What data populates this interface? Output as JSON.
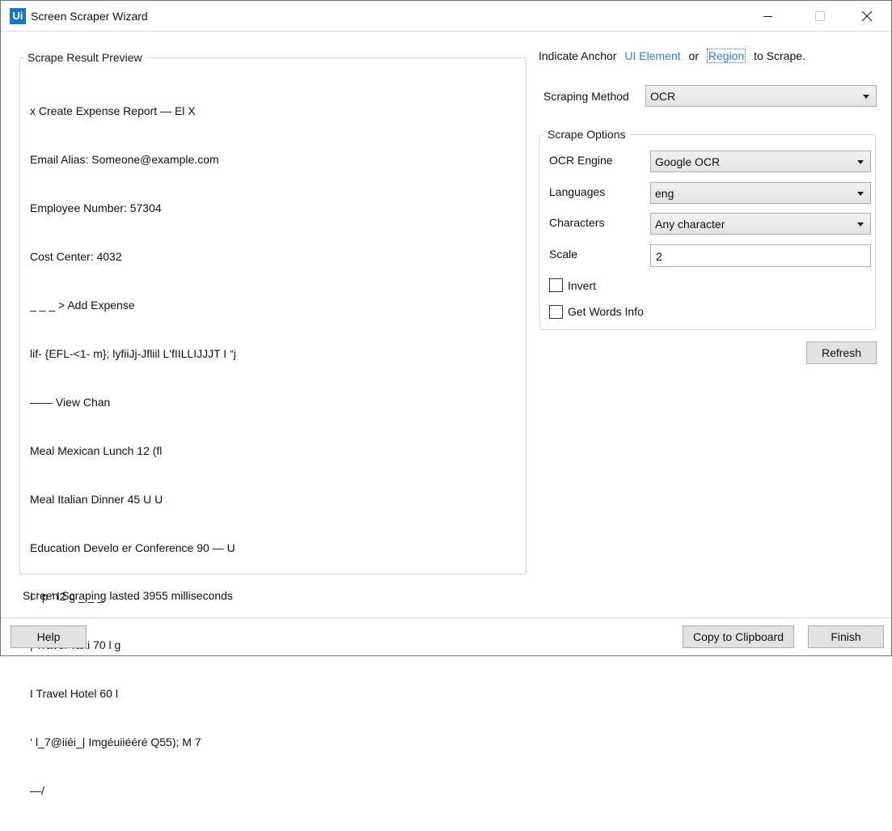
{
  "window": {
    "title": "Screen Scraper Wizard",
    "logo_text": "Ui"
  },
  "preview": {
    "legend": "Scrape Result Preview",
    "lines": [
      "x Create Expense Report — El X",
      "Email Alias: Someone@example.com",
      "Employee Number: 57304",
      "Cost Center: 4032",
      "_ _ _ > Add Expense",
      "lif- {EFL-<1- m}; lyfiiJj-Jfliil L'fIILLIJJJT I “j",
      "—— View Chan",
      "Meal Mexican Lunch 12 (fl",
      "Meal Italian Dinner 45 U U",
      "Education Develo er Conference 90 — U",
      "I ‘ p ‘ l2 g _ _ _",
      "| Travel Taxi 70 l g",
      "I Travel Hotel 60 l",
      "‘ l_7@iiéi_| Imgéuiiééré Q55); M 7",
      "—/"
    ]
  },
  "status": "Screen Scraping lasted 3955 milliseconds",
  "anchor": {
    "prefix": "Indicate Anchor",
    "ui_element_link": "UI Element",
    "or_text": "or",
    "region_link": "Region",
    "suffix": "to Scrape."
  },
  "scraping_method": {
    "label": "Scraping Method",
    "value": "OCR"
  },
  "scrape_options": {
    "legend": "Scrape Options",
    "ocr_engine_label": "OCR Engine",
    "ocr_engine_value": "Google OCR",
    "languages_label": "Languages",
    "languages_value": "eng",
    "characters_label": "Characters",
    "characters_value": "Any character",
    "scale_label": "Scale",
    "scale_value": "2",
    "invert_label": "Invert",
    "invert_checked": false,
    "words_info_label": "Get Words Info",
    "words_info_checked": false
  },
  "buttons": {
    "refresh": "Refresh",
    "help": "Help",
    "copy": "Copy to Clipboard",
    "finish": "Finish"
  }
}
